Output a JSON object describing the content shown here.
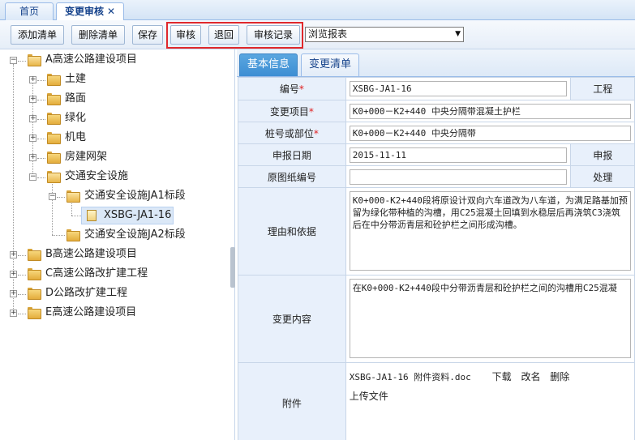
{
  "tabs": [
    {
      "label": "首页"
    },
    {
      "label": "变更审核",
      "close": "✕"
    }
  ],
  "toolbar": {
    "add_list": "添加清单",
    "delete_list": "删除清单",
    "save": "保存",
    "review": "审核",
    "return": "退回",
    "review_record": "审核记录",
    "report_select": "浏览报表"
  },
  "tree": {
    "a_project": "A高速公路建设项目",
    "civil": "土建",
    "road": "路面",
    "greening": "绿化",
    "mechanical": "机电",
    "housing": "房建网架",
    "traffic_safety": "交通安全设施",
    "ja1": "交通安全设施JA1标段",
    "xsbg": "XSBG-JA1-16",
    "ja2": "交通安全设施JA2标段",
    "b_project": "B高速公路建设项目",
    "c_project": "C高速公路改扩建工程",
    "d_project": "D公路改扩建工程",
    "e_project": "E高速公路建设项目"
  },
  "right_tabs": {
    "basic": "基本信息",
    "change_list": "变更清单"
  },
  "form": {
    "number_label": "编号",
    "number_value": "XSBG-JA1-16",
    "project_right_label": "工程",
    "change_item_label": "变更项目",
    "change_item_value": "K0+000－K2+440  中央分隔带混凝土护栏",
    "location_label": "桩号或部位",
    "location_value": "K0+000－K2+440  中央分隔带",
    "report_date_label": "申报日期",
    "report_date_value": "2015-11-11",
    "report_right_label": "申报",
    "drawing_label": "原图纸编号",
    "drawing_value": "",
    "handle_right_label": "处理",
    "reason_label": "理由和依据",
    "reason_value": "K0+000-K2+440段将原设计双向六车道改为八车道，为满足路基加预留为绿化带种植的沟槽，用C25混凝土回填到水稳层后再浇筑C3浇筑后在中分带沥青层和砼护栏之间形成沟槽。",
    "content_label": "变更内容",
    "content_value": "在K0+000-K2+440段中分带沥青层和砼护栏之间的沟槽用C25混凝",
    "attach_label": "附件",
    "attach_file": "XSBG-JA1-16 附件资料.doc",
    "download": "下载",
    "rename": "改名",
    "delete": "删除",
    "upload": "上传文件",
    "required_mark": "*"
  }
}
